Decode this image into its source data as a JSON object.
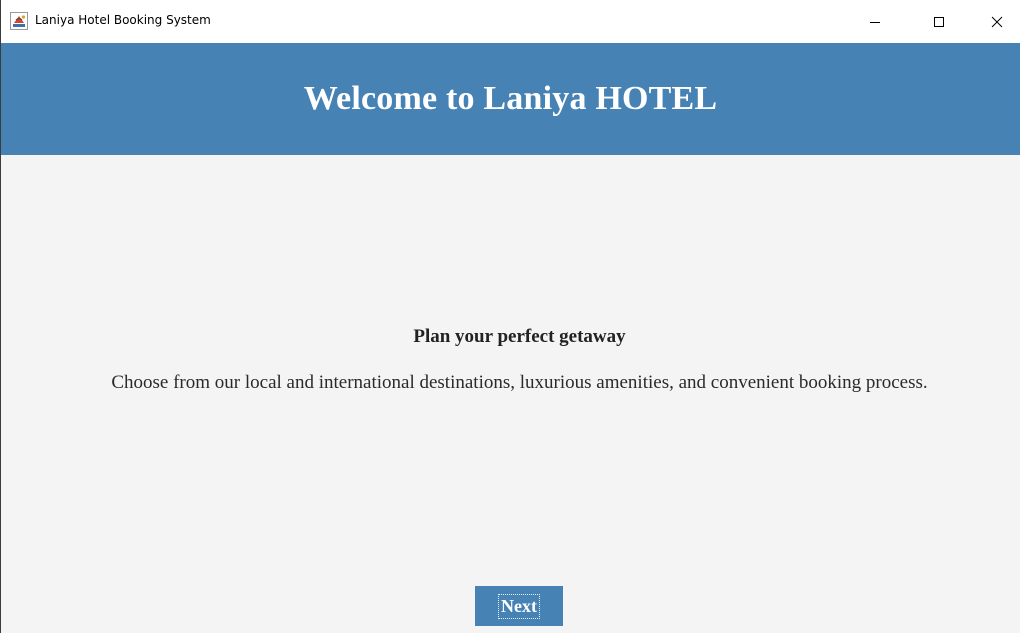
{
  "window": {
    "title": "Laniya Hotel Booking System",
    "app_icon": "java-cup-icon",
    "controls": {
      "minimize_icon": "minimize-icon",
      "maximize_icon": "maximize-icon",
      "close_icon": "close-icon"
    }
  },
  "header": {
    "title": "Welcome to Laniya HOTEL",
    "background_color": "#4682b4",
    "text_color": "#ffffff"
  },
  "main": {
    "tagline": "Plan your perfect getaway",
    "description": "Choose from our local and international destinations, luxurious amenities, and convenient booking process.",
    "background_color": "#f4f4f4"
  },
  "actions": {
    "next_label": "Next",
    "button_color": "#4682b4"
  }
}
